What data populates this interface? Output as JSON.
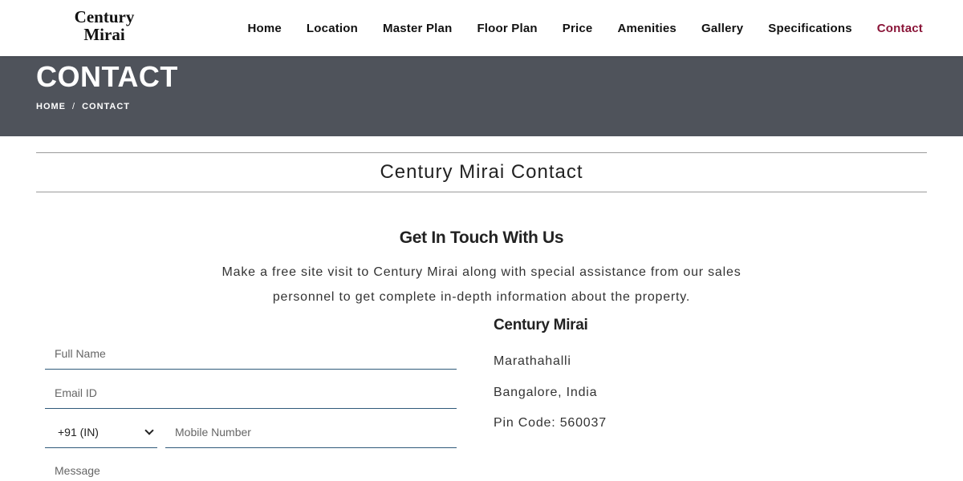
{
  "header": {
    "logo_line1": "Century",
    "logo_line2": "Mirai",
    "nav": [
      {
        "label": "Home"
      },
      {
        "label": "Location"
      },
      {
        "label": "Master Plan"
      },
      {
        "label": "Floor Plan"
      },
      {
        "label": "Price"
      },
      {
        "label": "Amenities"
      },
      {
        "label": "Gallery"
      },
      {
        "label": "Specifications"
      },
      {
        "label": "Contact",
        "active": true
      }
    ],
    "active_color": "#8a1538"
  },
  "banner": {
    "title": "CONTACT",
    "breadcrumb": {
      "home": "HOME",
      "separator": "/",
      "current": "CONTACT"
    },
    "background": "#4f535b"
  },
  "section": {
    "heading": "Century Mirai Contact",
    "touch_title": "Get In Touch With Us",
    "touch_desc": "Make a free site visit to Century Mirai along with special assistance from our sales personnel to get complete in-depth information about the property."
  },
  "form": {
    "name_placeholder": "Full Name",
    "email_placeholder": "Email ID",
    "country_code": "+91 (IN)",
    "mobile_placeholder": "Mobile Number",
    "message_placeholder": "Message"
  },
  "contact_info": {
    "title": "Century Mirai",
    "line1": "Marathahalli",
    "line2": "Bangalore, India",
    "line3": "Pin Code: 560037"
  }
}
